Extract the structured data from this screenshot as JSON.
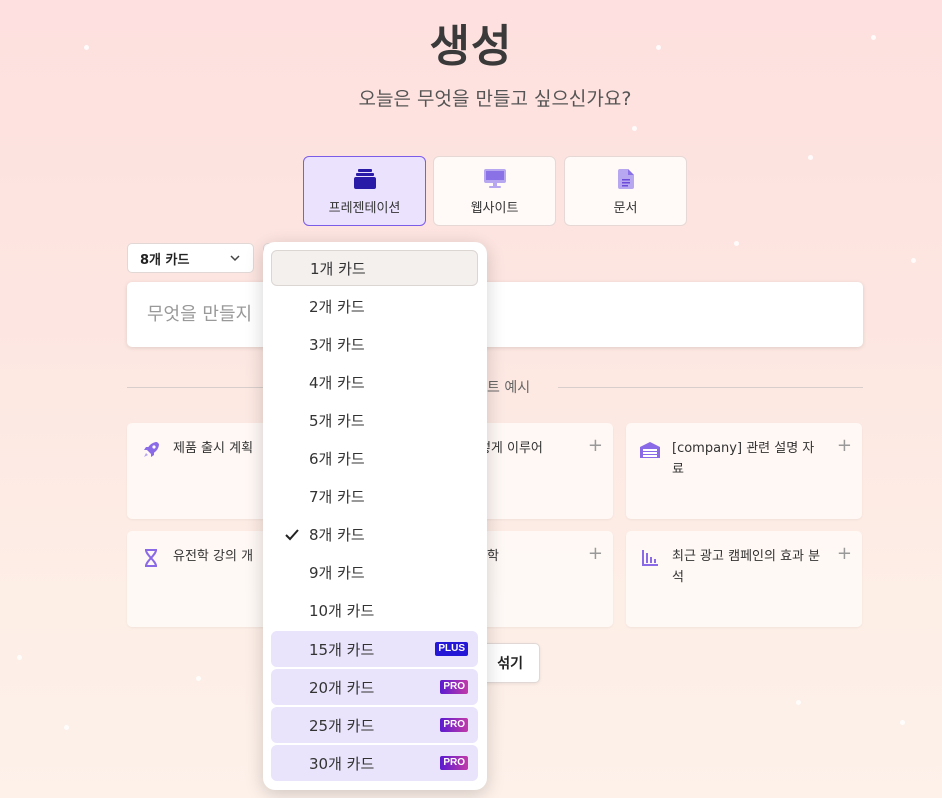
{
  "header": {
    "title": "생성",
    "subtitle": "오늘은 무엇을 만들고 싶으신가요?"
  },
  "types": [
    {
      "label": "프레젠테이션",
      "icon": "stack-icon",
      "selected": true
    },
    {
      "label": "웹사이트",
      "icon": "monitor-icon",
      "selected": false
    },
    {
      "label": "문서",
      "icon": "document-icon",
      "selected": false
    }
  ],
  "controls": {
    "card_count": "8개 카드"
  },
  "prompt": {
    "placeholder": "무엇을 만들지"
  },
  "examples": {
    "divider_label": "트 예시",
    "items": [
      {
        "text": "제품 출시 계획",
        "icon": "rocket-icon"
      },
      {
        "text": "어떻게 이루어",
        "icon": "none"
      },
      {
        "text": "[company] 관련 설명 자료",
        "icon": "building-icon"
      },
      {
        "text": "유전학 강의 개",
        "icon": "dna-icon"
      },
      {
        "text": "학",
        "icon": "none"
      },
      {
        "text": "최근 광고 캠페인의 효과 분석",
        "icon": "bar-chart-icon"
      }
    ],
    "shuffle_label": "섞기"
  },
  "dropdown": {
    "options": [
      {
        "label": "1개 카드",
        "badge": ""
      },
      {
        "label": "2개 카드",
        "badge": ""
      },
      {
        "label": "3개 카드",
        "badge": ""
      },
      {
        "label": "4개 카드",
        "badge": ""
      },
      {
        "label": "5개 카드",
        "badge": ""
      },
      {
        "label": "6개 카드",
        "badge": ""
      },
      {
        "label": "7개 카드",
        "badge": ""
      },
      {
        "label": "8개 카드",
        "badge": ""
      },
      {
        "label": "9개 카드",
        "badge": ""
      },
      {
        "label": "10개 카드",
        "badge": ""
      },
      {
        "label": "15개 카드",
        "badge": "PLUS"
      },
      {
        "label": "20개 카드",
        "badge": "PRO"
      },
      {
        "label": "25개 카드",
        "badge": "PRO"
      },
      {
        "label": "30개 카드",
        "badge": "PRO"
      }
    ],
    "selected_index": 7,
    "highlighted_index": 0
  },
  "colors": {
    "accent": "#6b4bd8",
    "plus_badge": "#2418d6",
    "pro_badge": "#7a20c0"
  }
}
